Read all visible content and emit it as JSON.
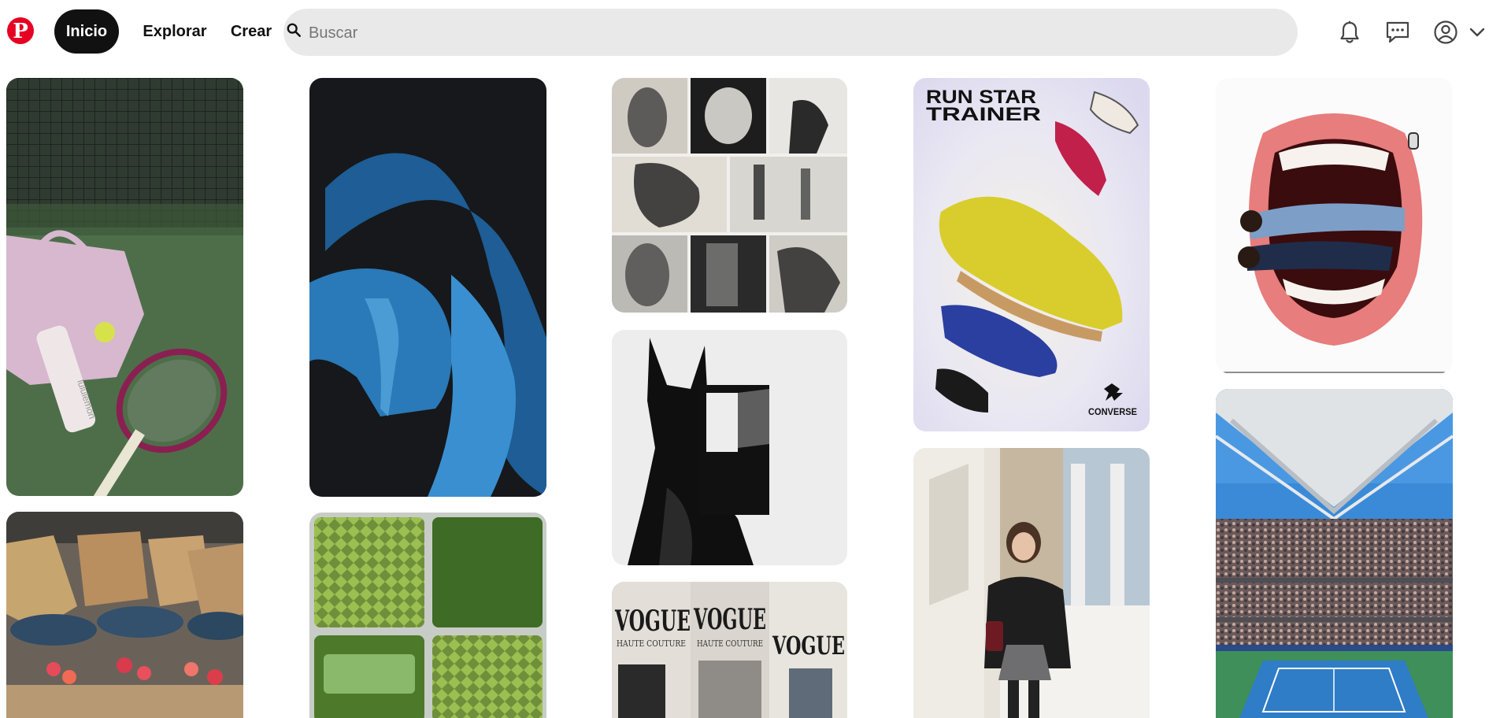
{
  "header": {
    "logo_letter": "P",
    "nav": {
      "home": "Inicio",
      "explore": "Explorar",
      "create": "Crear"
    },
    "search_placeholder": "Buscar",
    "icons": [
      "bell-icon",
      "chat-icon",
      "profile-icon",
      "chevron-down-icon"
    ]
  },
  "colors": {
    "brand": "#e60023",
    "search_bg": "#e9e9e9",
    "active_nav": "#111111"
  },
  "pins": [
    {
      "name": "pin-tennis-bag",
      "texts": {
        "bottle": "lululemon"
      }
    },
    {
      "name": "pin-blue-figure"
    },
    {
      "name": "pin-motion-blur-collage"
    },
    {
      "name": "pin-run-star-trainer",
      "texts": {
        "headline_1": "RUN STAR",
        "headline_2": "TRAINER",
        "brand": "CONVERSE"
      }
    },
    {
      "name": "pin-mouth-collage"
    },
    {
      "name": "pin-tulips"
    },
    {
      "name": "pin-green-glass-tiles"
    },
    {
      "name": "pin-doberman-graphic"
    },
    {
      "name": "pin-vogue-magazines",
      "texts": {
        "mag_1": "VOGUE",
        "mag_2": "VOGUE",
        "mag_3": "VOGUE",
        "mag_sub_1": "HAUTE COUTURE",
        "mag_sub_2": "HAUTE COUTURE"
      }
    },
    {
      "name": "pin-street-style"
    },
    {
      "name": "pin-tennis-stadium"
    }
  ]
}
